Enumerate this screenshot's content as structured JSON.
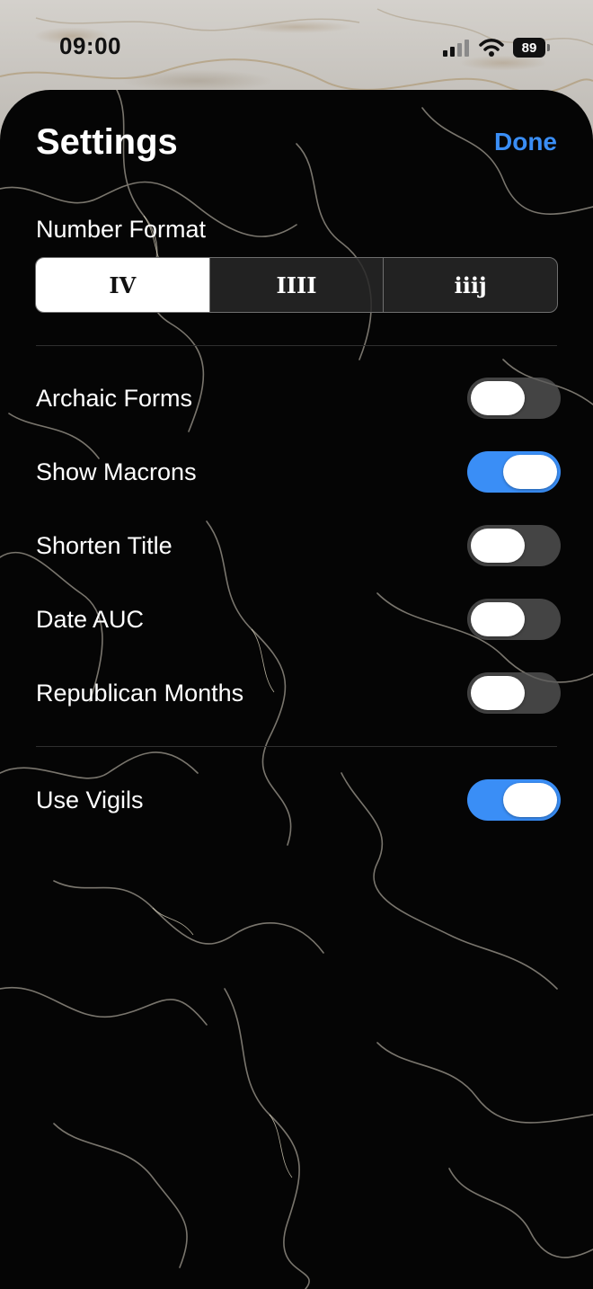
{
  "status_bar": {
    "time": "09:00",
    "battery": "89"
  },
  "header": {
    "title": "Settings",
    "done_label": "Done"
  },
  "number_format": {
    "label": "Number Format",
    "options": [
      "IV",
      "IIII",
      "iiij"
    ],
    "selected_index": 0
  },
  "toggles": [
    {
      "label": "Archaic Forms",
      "on": false
    },
    {
      "label": "Show Macrons",
      "on": true
    },
    {
      "label": "Shorten Title",
      "on": false
    },
    {
      "label": "Date AUC",
      "on": false
    },
    {
      "label": "Republican Months",
      "on": false
    }
  ],
  "vigils": {
    "label": "Use Vigils",
    "on": true
  },
  "colors": {
    "accent": "#3a8ef6",
    "sheet": "#050505",
    "toggle_off": "#5a5a5a"
  },
  "icons": [
    "cellular-signal-icon",
    "wifi-icon",
    "battery-icon"
  ]
}
